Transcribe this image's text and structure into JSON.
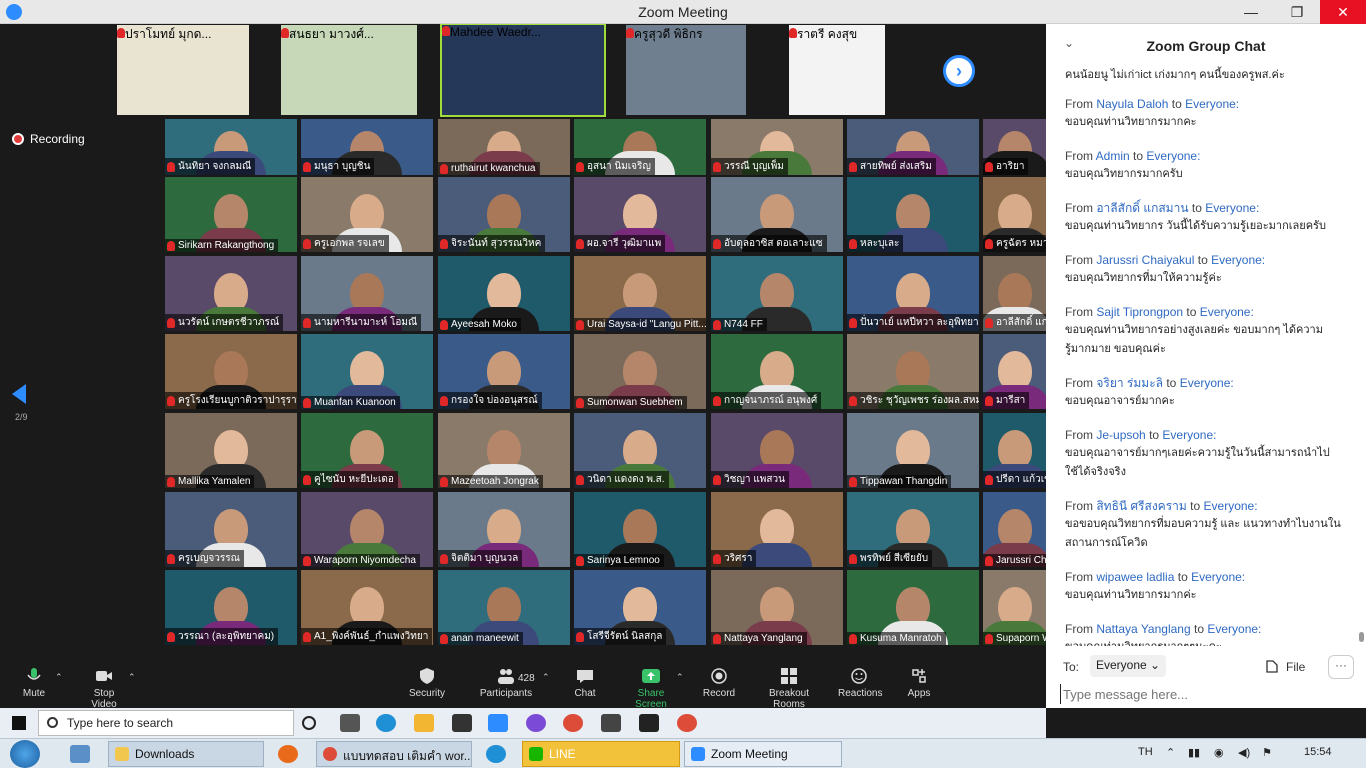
{
  "window": {
    "title": "Zoom Meeting",
    "minimize": "—",
    "restore": "❐",
    "close": "✕"
  },
  "recording": {
    "label": "Recording"
  },
  "pagination": {
    "indicator": "2/9"
  },
  "strip": [
    {
      "name": "ปราโมทย์ มุกด..."
    },
    {
      "name": "สนธยา มาวงศ์..."
    },
    {
      "name": "Mahdee Waedr..."
    },
    {
      "name": "ครูสุวดี พิธิกร"
    },
    {
      "name": "ราตรี คงสุข"
    }
  ],
  "gallery": [
    [
      "นันทิยา จงกลมณี",
      "มนุธา บุญชิน",
      "ruthairut kwanchua",
      "อุสนา นิมเจริญ",
      "วรรณี บุญเพ็ม",
      "สายทิพย์ ส่งเสริม",
      "อาริยา"
    ],
    [
      "Sirikarn Rakangthong",
      "ครูเอกพล รจเลข",
      "จิระนันท์ สุวรรณวิหค",
      "ผอ.จารี วุฒิมาแพ",
      "อับดุลอาซิส ดอเลาะแซ",
      "หละบุเละ",
      "ครูฉัตร หมาด"
    ],
    [
      "นวรัตน์ เกษตรชีวาภรณ์",
      "นามหารีนามาะห์ โอมณี",
      "Ayeesah Moko",
      "Urai Saysa-id \"Langu Pitt...",
      "N744 FF",
      "ปั่นวาเย์ แหปีหวา ละอุพิทยาคม",
      "อาลีสักดิ์ แก"
    ],
    [
      "ครูโรงเรียนบูกาติวราปารุราษฎร์...",
      "Muanfan Kuanoon",
      "กรองใจ บ่องอนุสรณ์",
      "Sumonwan Suebhem",
      "กาญจนาภรณ์ อนุพงศ์",
      "วชิระ ชุวัญเพชร ร่องผล.สหมง...",
      "มารีสา"
    ],
    [
      "Mallika Yamalen",
      "คูไซนับ หะยีปะเดอ",
      "Mazeetoah Jongrak",
      "วนิดา แดงดง พ.ส.",
      "วิชญา แพสวน",
      "Tippawan Thangdin",
      "ปรีดา แก้วเข้"
    ],
    [
      "ครูเบญจวรรณ",
      "Waraporn Niyomdecha",
      "จิตติมา บุญนวล",
      "Sarinya Lemnoo",
      "วริศรา",
      "พรทิพย์ สีเซียยับ",
      "Jarussri Ch"
    ],
    [
      "วรรณา (ละอุพิทยาคม)",
      "A1_พิงค์พันธ์_กำแพงวิทยา",
      "anan maneewit",
      "โสรีจีรัตน์ นิลสกุล",
      "Nattaya Yanglang",
      "Kusuma Manratoh",
      "Supaporn W"
    ]
  ],
  "toolbar": {
    "mute": "Mute",
    "stop_video": "Stop Video",
    "security": "Security",
    "participants": "Participants",
    "participant_count": "428",
    "chat": "Chat",
    "share": "Share Screen",
    "record": "Record",
    "breakout": "Breakout Rooms",
    "reactions": "Reactions",
    "apps": "Apps"
  },
  "chat": {
    "title": "Zoom Group Chat",
    "top_line": "คนน้อยนู ไม่เก่าict เก่งมากๆ คนนี้ของครูพส.ค่ะ",
    "from_word": "From",
    "to_word": "to",
    "everyone": "Everyone:",
    "messages": [
      {
        "sender": "Nayula Daloh",
        "text": "ขอบคุณท่านวิทยากรมากคะ"
      },
      {
        "sender": "Admin",
        "text": "ขอบคุณวิทยากรมากครับ"
      },
      {
        "sender": "อาลีสักดิ์ แกสมาน",
        "text": "ขอบคุณท่านวิทยากร วันนี้ได้รับความรู้เยอะมากเลยครับ"
      },
      {
        "sender": "Jarussri Chaiyakul",
        "text": "ขอบคุณวิทยากรที่มาให้ความรู้ค่ะ"
      },
      {
        "sender": "Sajit Tiprongpon",
        "text": "ขอบคุณท่านวิทยากรอย่างสูงเลยค่ะ ขอบมากๆ ได้ความรู้มากมาย ขอบคุณค่ะ"
      },
      {
        "sender": "จริยา ร่มมะลิ",
        "text": "ขอบคุณอาจารย์มากคะ"
      },
      {
        "sender": "Je-upsoh",
        "text": "ขอบคุณอาจารย์มากๆเลยค่ะความรู้ในวันนี้สามารถนำไปใช้ได้จริงจริง"
      },
      {
        "sender": "สิทธินี ศรีสงคราม",
        "text": "ขอขอบคุณวิทยากรที่มอบความรู้ และ แนวทางทำไบงานในสถานการณ์โควิด"
      },
      {
        "sender": "wipawee ladlia",
        "text": "ขอบคุณท่านวิทยากรมากค่ะ"
      },
      {
        "sender": "Nattaya Yanglang",
        "text": "ขอบคุณท่านวิทยากรมากๆๆนะคะ"
      }
    ],
    "to_label": "To:",
    "to_value": "Everyone ⌄",
    "file_label": "File",
    "more_label": "···",
    "placeholder": "Type message here..."
  },
  "taskbar": {
    "search_placeholder": "Type here to search",
    "tasks": [
      {
        "label": "Downloads"
      },
      {
        "label": "แบบทดสอบ เติมคำ wor..."
      },
      {
        "label": "LINE"
      },
      {
        "label": "Zoom Meeting"
      }
    ],
    "lang": "TH",
    "time": "15:54"
  },
  "colors": {
    "accent": "#2d8cff",
    "mic_off": "#e02828",
    "share_green": "#3ac26a",
    "chat_name": "#2f6ac2"
  }
}
